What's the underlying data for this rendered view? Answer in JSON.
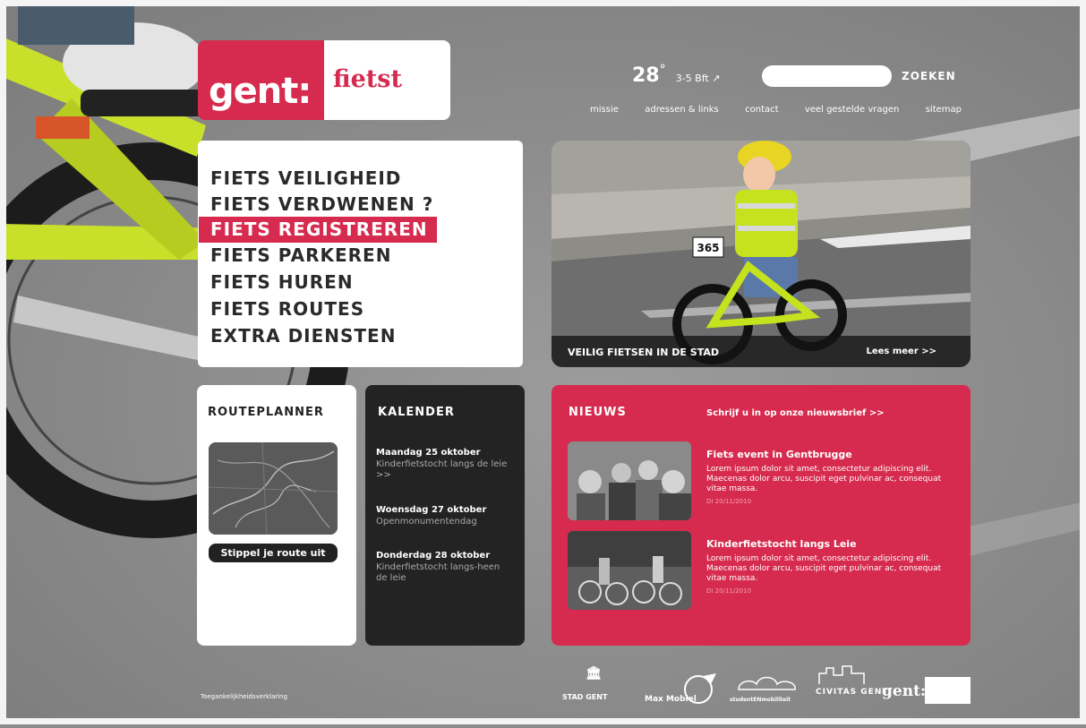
{
  "logo": {
    "left": "gent:",
    "right": "fietst"
  },
  "weather": {
    "temp": "28",
    "deg": "°",
    "wind": "3-5 Bft ↗"
  },
  "search": {
    "placeholder": "",
    "button": "ZOEKEN"
  },
  "toplinks": [
    "missie",
    "adressen & links",
    "contact",
    "veel gestelde vragen",
    "sitemap"
  ],
  "menu": {
    "items": [
      "FIETS VEILIGHEID",
      "FIETS VERDWENEN ?",
      "FIETS REGISTREREN",
      "FIETS PARKEREN",
      "FIETS HUREN",
      "FIETS ROUTES",
      "EXTRA DIENSTEN"
    ],
    "active": "FIETS REGISTREREN"
  },
  "hero": {
    "caption": "VEILIG FIETSEN IN DE STAD",
    "more": "Lees meer >>",
    "bib": "365"
  },
  "routeplanner": {
    "heading": "ROUTEPLANNER",
    "button": "Stippel je route uit"
  },
  "kalender": {
    "heading": "KALENDER",
    "events": [
      {
        "date": "Maandag 25 oktober",
        "desc": "Kinderfietstocht langs de leie >>"
      },
      {
        "date": "Woensdag 27 oktober",
        "desc": "Openmonumentendag"
      },
      {
        "date": "Donderdag 28 oktober",
        "desc": "Kinderfietstocht langs-heen de leie"
      }
    ]
  },
  "nieuws": {
    "heading": "NIEUWS",
    "subscribe": "Schrijf u in op onze nieuwsbrief >>",
    "items": [
      {
        "title": "Fiets event in Gentbrugge",
        "body": "Lorem ipsum dolor sit amet, consectetur adipiscing elit. Maecenas dolor arcu, suscipit eget pulvinar ac, consequat vitae massa.",
        "date": "DI 20/11/2010"
      },
      {
        "title": "Kinderfietstocht langs Leie",
        "body": "Lorem ipsum dolor sit amet, consectetur adipiscing elit. Maecenas dolor arcu, suscipit eget pulvinar ac, consequat vitae massa.",
        "date": "DI 20/11/2010"
      }
    ]
  },
  "footer": {
    "accessibility": "Toegankelijkheidsverklaring",
    "partners": [
      "STAD GENT",
      "Max Mobiel",
      "studentENmobiliteit",
      "CIVITAS GENT",
      "gent:"
    ]
  },
  "colors": {
    "brand": "#d62b4e",
    "dark": "#232323",
    "white": "#ffffff"
  }
}
